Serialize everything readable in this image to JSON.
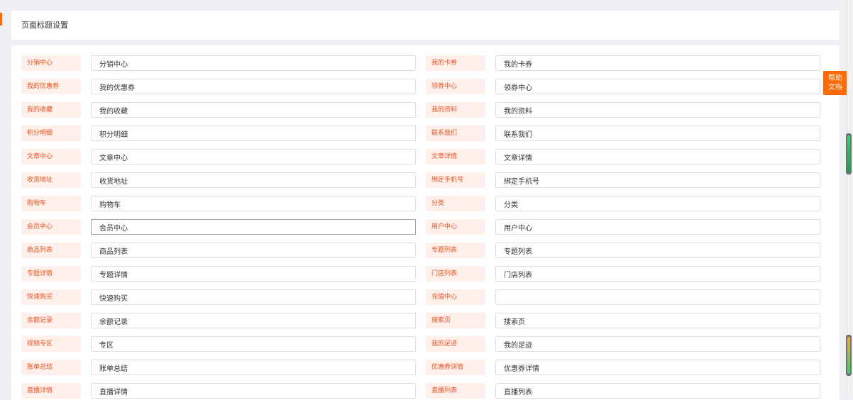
{
  "header": {
    "title": "页面标题设置"
  },
  "help": {
    "line1": "帮助",
    "line2": "文档"
  },
  "fields": [
    {
      "label": "分销中心",
      "value": "分销中心"
    },
    {
      "label": "我的卡券",
      "value": "我的卡券"
    },
    {
      "label": "我的优惠券",
      "value": "我的优惠券"
    },
    {
      "label": "领券中心",
      "value": "领券中心"
    },
    {
      "label": "我的收藏",
      "value": "我的收藏"
    },
    {
      "label": "我的资料",
      "value": "我的资料"
    },
    {
      "label": "积分明细",
      "value": "积分明细"
    },
    {
      "label": "联系我们",
      "value": "联系我们"
    },
    {
      "label": "文章中心",
      "value": "文章中心"
    },
    {
      "label": "文章详情",
      "value": "文章详情"
    },
    {
      "label": "收货地址",
      "value": "收货地址"
    },
    {
      "label": "绑定手机号",
      "value": "绑定手机号"
    },
    {
      "label": "购物车",
      "value": "购物车"
    },
    {
      "label": "分类",
      "value": "分类"
    },
    {
      "label": "会员中心",
      "value": "会员中心"
    },
    {
      "label": "用户中心",
      "value": "用户中心"
    },
    {
      "label": "商品列表",
      "value": "商品列表"
    },
    {
      "label": "专题列表",
      "value": "专题列表"
    },
    {
      "label": "专题详情",
      "value": "专题详情"
    },
    {
      "label": "门店列表",
      "value": "门店列表"
    },
    {
      "label": "快速购买",
      "value": "快速购买"
    },
    {
      "label": "充值中心",
      "value": ""
    },
    {
      "label": "余额记录",
      "value": "余额记录"
    },
    {
      "label": "搜索页",
      "value": "搜索页"
    },
    {
      "label": "视频专区",
      "value": "专区"
    },
    {
      "label": "我的足迹",
      "value": "我的足迹"
    },
    {
      "label": "账单总结",
      "value": "账单总结"
    },
    {
      "label": "优惠券详情",
      "value": "优惠券详情"
    },
    {
      "label": "直播详情",
      "value": "直播详情"
    },
    {
      "label": "直播列表",
      "value": "直播列表"
    }
  ],
  "colors": {
    "accent": "#ff6a00",
    "label_bg": "#fff0eb",
    "label_text": "#f4511e"
  }
}
